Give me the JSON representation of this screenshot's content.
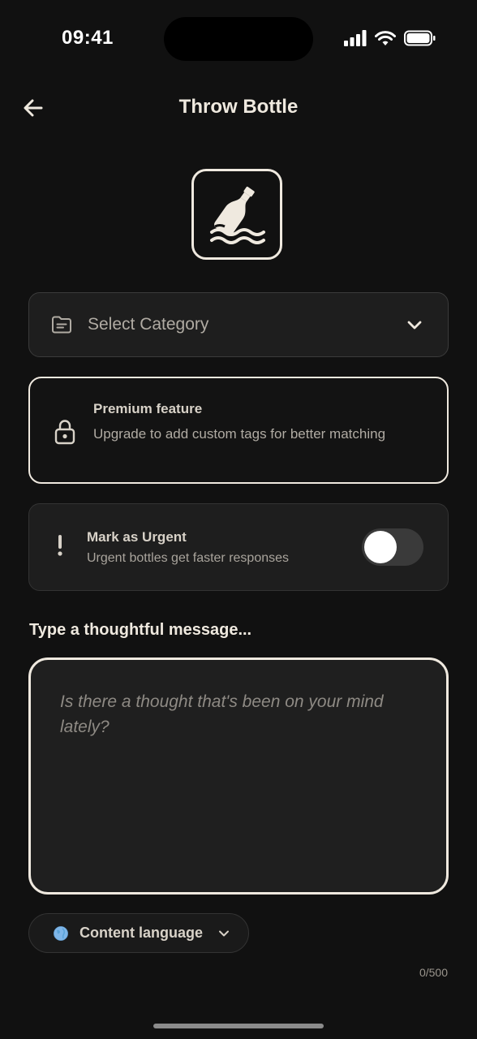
{
  "status_bar": {
    "time": "09:41",
    "icons": [
      "signal-icon",
      "wifi-icon",
      "battery-icon"
    ]
  },
  "header": {
    "back_icon": "arrow-left-icon",
    "title": "Throw Bottle"
  },
  "hero": {
    "icon": "message-in-bottle-icon"
  },
  "category_select": {
    "icon": "folder-icon",
    "placeholder": "Select Category",
    "chevron": "chevron-down-icon"
  },
  "premium_card": {
    "icon": "lock-icon",
    "title": "Premium feature",
    "description": "Upgrade to add custom tags for better matching"
  },
  "urgent_card": {
    "icon": "exclamation-icon",
    "title": "Mark as Urgent",
    "description": "Urgent bottles get faster responses",
    "toggle_on": false
  },
  "message": {
    "label": "Type a thoughtful message...",
    "placeholder": "Is there a thought that's been on your mind lately?",
    "value": ""
  },
  "language_select": {
    "icon": "globe-icon",
    "label": "Content language",
    "chevron": "chevron-down-icon"
  },
  "char_counter": "0/500",
  "colors": {
    "background": "#111111",
    "surface": "#1e1e1e",
    "accent": "#efe9df",
    "muted_text": "#b0aba3"
  }
}
